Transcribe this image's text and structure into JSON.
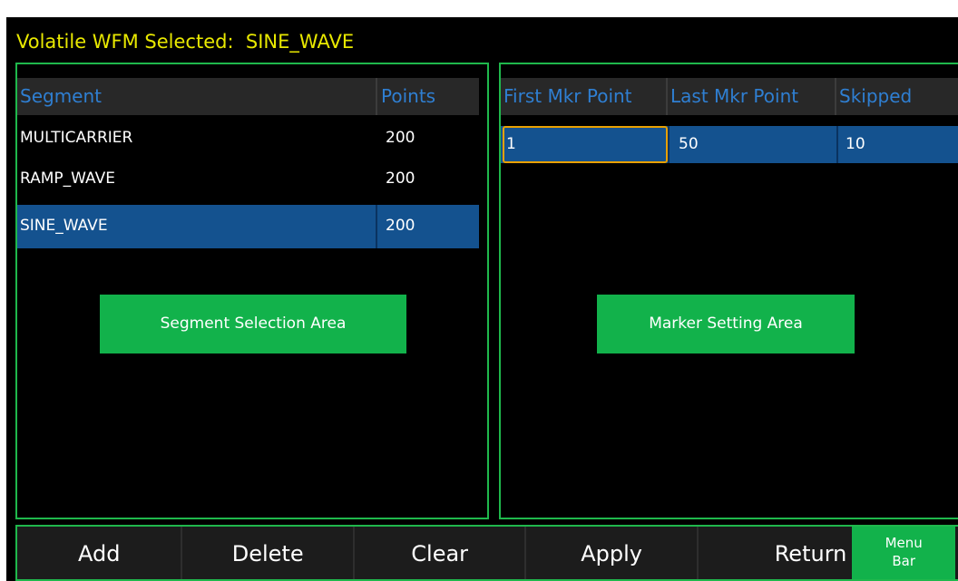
{
  "title": {
    "label": "Volatile WFM Selected:",
    "value": "SINE_WAVE"
  },
  "segment_table": {
    "headers": [
      "Segment",
      "Points"
    ],
    "rows": [
      {
        "segment": "MULTICARRIER",
        "points": "200",
        "selected": false
      },
      {
        "segment": "RAMP_WAVE",
        "points": "200",
        "selected": false
      },
      {
        "segment": "SINE_WAVE",
        "points": "200",
        "selected": true
      }
    ],
    "area_label": "Segment Selection Area"
  },
  "marker_table": {
    "headers": [
      "First Mkr Point",
      "Last Mkr Point",
      "Skipped"
    ],
    "rows": [
      {
        "first": "1",
        "last": "50",
        "skipped": "10"
      }
    ],
    "area_label": "Marker Setting Area"
  },
  "menu_bar": {
    "buttons": [
      "Add",
      "Delete",
      "Clear",
      "Apply",
      "Return"
    ],
    "menu_label_line1": "Menu",
    "menu_label_line2": "Bar"
  },
  "colors": {
    "title_text": "#e8e800",
    "panel_border": "#1fb84c",
    "header_text": "#2f7fd2",
    "selected_row": "#14528f",
    "focus_outline": "#e8a000",
    "area_label_bg": "#12b24b"
  }
}
